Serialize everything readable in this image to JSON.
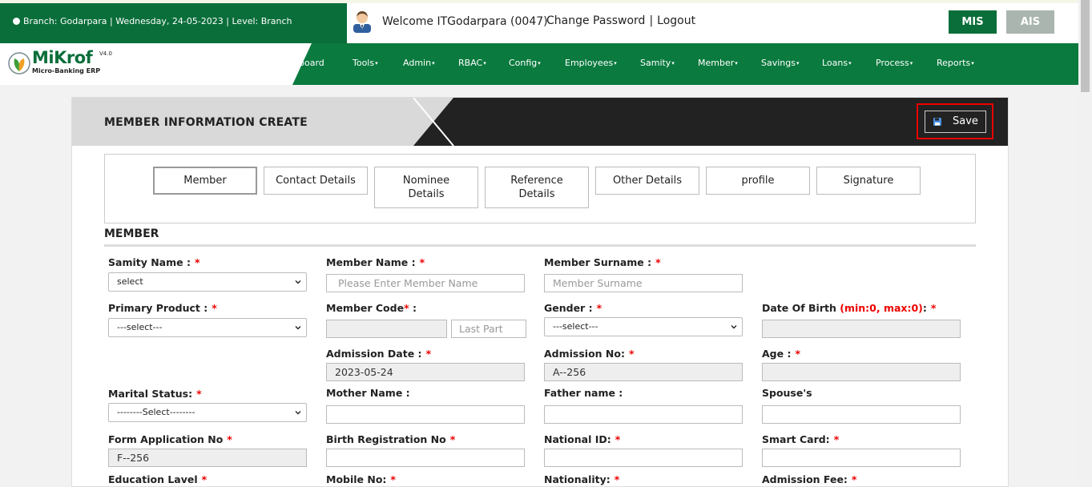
{
  "header": {
    "branch_info": "Branch: Godarpara | Wednesday, 24-05-2023 | Level: Branch",
    "welcome": "Welcome ITGodarpara (0047)",
    "change_password": "Change Password",
    "separator": "|",
    "logout": "Logout",
    "mis_label": "MIS",
    "ais_label": "AIS"
  },
  "logo": {
    "name": "MiKrof",
    "version": "V4.0",
    "subtitle": "Micro-Banking ERP"
  },
  "nav": {
    "items": [
      {
        "label": "board",
        "caret": ""
      },
      {
        "label": "Tools",
        "caret": "▾"
      },
      {
        "label": "Admin",
        "caret": "▾"
      },
      {
        "label": "RBAC",
        "caret": "▾"
      },
      {
        "label": "Config",
        "caret": "▾"
      },
      {
        "label": "Employees",
        "caret": "▾"
      },
      {
        "label": "Samity",
        "caret": "▾"
      },
      {
        "label": "Member",
        "caret": "▾"
      },
      {
        "label": "Savings",
        "caret": "▾"
      },
      {
        "label": "Loans",
        "caret": "▾"
      },
      {
        "label": "Process",
        "caret": "▾"
      },
      {
        "label": "Reports",
        "caret": "▾"
      }
    ]
  },
  "panel": {
    "title": "MEMBER INFORMATION CREATE",
    "save_label": "Save"
  },
  "tabs": [
    {
      "label": "Member"
    },
    {
      "label": "Contact Details"
    },
    {
      "label": "Nominee Details"
    },
    {
      "label": "Reference Details"
    },
    {
      "label": "Other Details"
    },
    {
      "label": "profile"
    },
    {
      "label": "Signature"
    }
  ],
  "section": {
    "title": "MEMBER"
  },
  "form": {
    "samity_name": {
      "label": "Samity Name :",
      "req": "*",
      "value": "select"
    },
    "member_name": {
      "label": "Member Name :",
      "req": "*",
      "placeholder": "Please Enter Member Name"
    },
    "member_surname": {
      "label": "Member Surname :",
      "req": "*",
      "placeholder": "Member Surname"
    },
    "primary_product": {
      "label": "Primary Product :",
      "req": "*",
      "value": "---select---"
    },
    "member_code": {
      "label": "Member Code",
      "req": "*",
      "colon": ":",
      "value": "",
      "last_part_placeholder": "Last Part"
    },
    "gender": {
      "label": "Gender :",
      "req": "*",
      "value": "---select---"
    },
    "date_of_birth": {
      "label": "Date Of Birth",
      "note": "(min:0, max:0)",
      "colon": ":",
      "req": "*",
      "value": ""
    },
    "admission_date": {
      "label": "Admission Date :",
      "req": "*",
      "value": "2023-05-24"
    },
    "admission_no": {
      "label": "Admission No:",
      "req": "*",
      "value": "A--256"
    },
    "age": {
      "label": "Age :",
      "req": "*",
      "value": ""
    },
    "marital_status": {
      "label": "Marital Status:",
      "req": "*",
      "value": "--------Select--------"
    },
    "mother_name": {
      "label": "Mother Name :",
      "value": ""
    },
    "father_name": {
      "label": "Father name :",
      "value": ""
    },
    "spouse": {
      "label": "Spouse's",
      "value": ""
    },
    "form_application_no": {
      "label": "Form Application No",
      "req": "*",
      "value": "F--256"
    },
    "birth_registration_no": {
      "label": "Birth Registration No",
      "req": "*",
      "value": ""
    },
    "national_id": {
      "label": "National ID:",
      "req": "*",
      "value": ""
    },
    "smart_card": {
      "label": "Smart Card:",
      "req": "*",
      "value": ""
    },
    "education_level": {
      "label": "Education Lavel",
      "req": "*"
    },
    "mobile_no": {
      "label": "Mobile No:",
      "req": "*"
    },
    "nationality": {
      "label": "Nationality:",
      "req": "*"
    },
    "admission_fee": {
      "label": "Admission Fee:",
      "req": "*"
    }
  },
  "colors": {
    "brand_green": "#0a7a3e",
    "dark_header": "#222222",
    "required_red": "#e00000",
    "ais_grey": "#a9b5ae"
  }
}
